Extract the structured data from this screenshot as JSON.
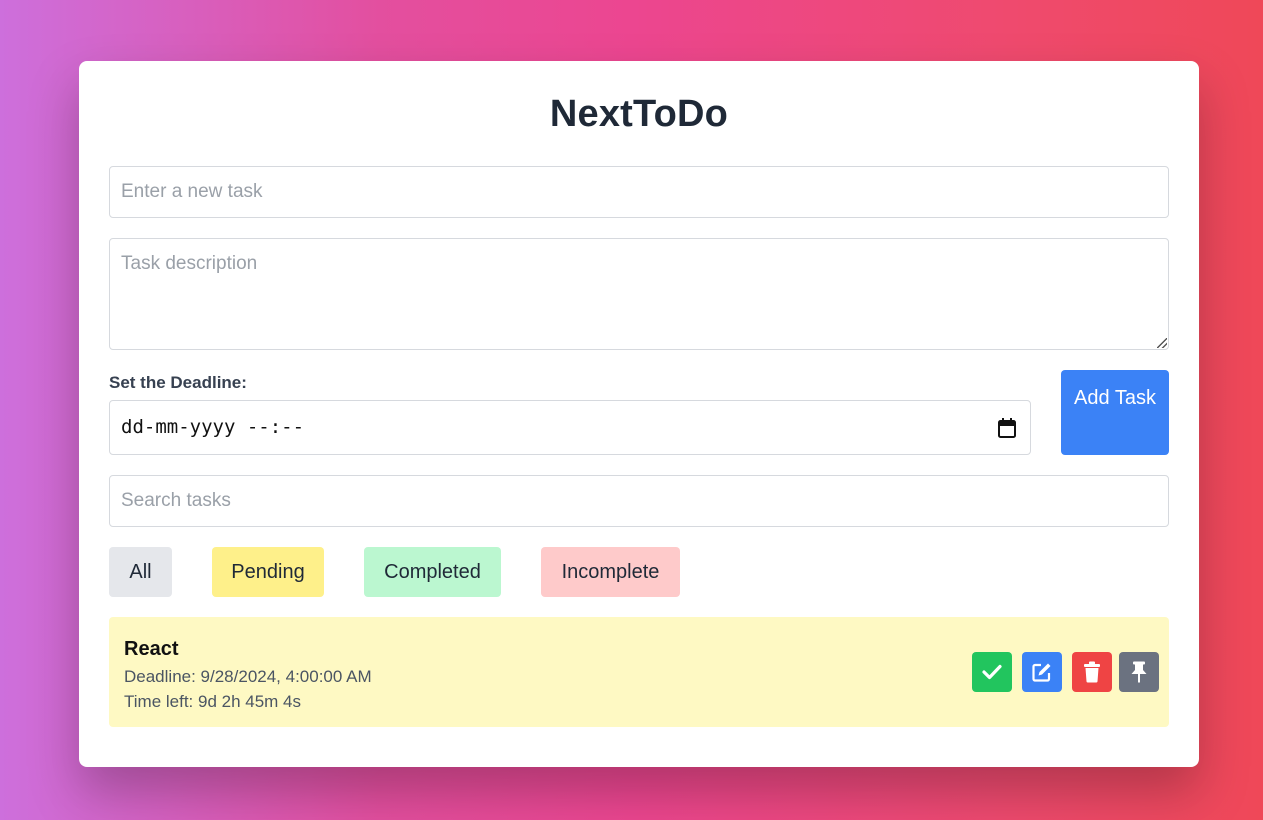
{
  "app": {
    "title": "NextToDo"
  },
  "form": {
    "task_placeholder": "Enter a new task",
    "task_value": "",
    "description_placeholder": "Task description",
    "description_value": "",
    "deadline_label": "Set the Deadline:",
    "deadline_value": "dd-mm-yyyy --:--",
    "add_button_label": "Add Task"
  },
  "search": {
    "placeholder": "Search tasks",
    "value": ""
  },
  "filters": [
    {
      "label": "All",
      "color": "#e5e7eb"
    },
    {
      "label": "Pending",
      "color": "#fef08a"
    },
    {
      "label": "Completed",
      "color": "#bbf7d0"
    },
    {
      "label": "Incomplete",
      "color": "#fecaca"
    }
  ],
  "tasks": [
    {
      "title": "React",
      "deadline": "Deadline: 9/28/2024, 4:00:00 AM",
      "time_left": "Time left: 9d 2h 45m 4s",
      "status_color": "#fef9c3",
      "actions": [
        {
          "icon": "check-icon",
          "color": "#22c55e"
        },
        {
          "icon": "edit-icon",
          "color": "#3b82f6"
        },
        {
          "icon": "trash-icon",
          "color": "#ef4444"
        },
        {
          "icon": "pin-icon",
          "color": "#6b7280"
        }
      ]
    }
  ],
  "colors": {
    "accent": "#3b82f6",
    "title": "#1f2937"
  }
}
